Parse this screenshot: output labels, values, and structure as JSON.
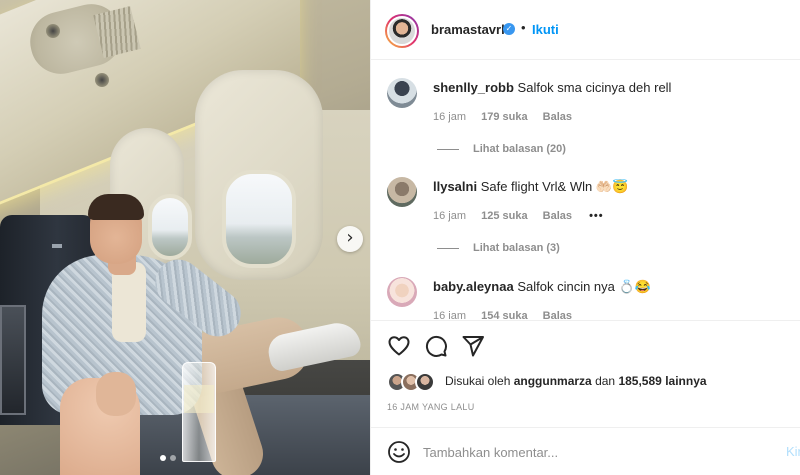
{
  "post": {
    "author": "bramastavrl",
    "separator": "•",
    "follow_label": "Ikuti",
    "carousel_next_glyph": "›"
  },
  "comments": [
    {
      "user": "shenlly_robb",
      "text": "Salfok sma cicinya deh rell",
      "time": "16 jam",
      "likes": "179 suka",
      "reply": "Balas",
      "view_replies": "Lihat balasan (20)",
      "avatar_icon": "person-avatar"
    },
    {
      "user": "llysalni",
      "text": "Safe flight Vrl& Wln 🤲🏻😇",
      "time": "16 jam",
      "likes": "125 suka",
      "reply": "Balas",
      "more": "•••",
      "view_replies": "Lihat balasan (3)",
      "avatar_icon": "person-avatar"
    },
    {
      "user": "baby.aleynaa",
      "text": "Salfok cincin nya 💍😂",
      "time": "16 jam",
      "likes": "154 suka",
      "reply": "Balas",
      "avatar_icon": "person-avatar"
    }
  ],
  "actions": {
    "icons": [
      "heart-icon",
      "comment-icon",
      "share-icon"
    ]
  },
  "likes": {
    "prefix": "Disukai oleh",
    "user": "anggunmarza",
    "middle": "dan",
    "count": "185,589",
    "suffix": "lainnya"
  },
  "timestamp": "16 JAM YANG LALU",
  "add_comment": {
    "placeholder": "Tambahkan komentar...",
    "post_label": "Kirim"
  },
  "colors": {
    "link_blue": "#0095f6",
    "verified_blue": "#3897f0",
    "muted_text": "#8e8e8e",
    "text": "#262626"
  }
}
